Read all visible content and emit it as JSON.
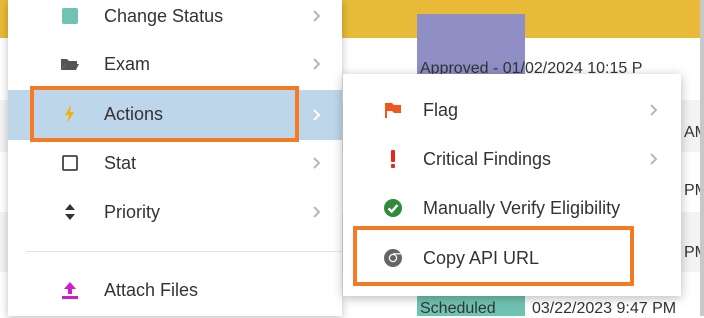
{
  "menu": {
    "items": [
      {
        "label": "Change Status",
        "icon": "change-status-icon",
        "submenu": true
      },
      {
        "label": "Exam",
        "icon": "folder-open-icon",
        "submenu": true
      },
      {
        "label": "Actions",
        "icon": "lightning-icon",
        "submenu": true,
        "selected": true
      },
      {
        "label": "Stat",
        "icon": "checkbox-icon",
        "submenu": true
      },
      {
        "label": "Priority",
        "icon": "sort-icon",
        "submenu": true
      },
      {
        "label": "Attach Files",
        "icon": "upload-icon",
        "submenu": false
      }
    ]
  },
  "submenu": {
    "items": [
      {
        "label": "Flag",
        "icon": "flag-icon",
        "submenu": true
      },
      {
        "label": "Critical Findings",
        "icon": "exclamation-icon",
        "submenu": true
      },
      {
        "label": "Manually Verify Eligibility",
        "icon": "check-circle-icon",
        "submenu": false
      },
      {
        "label": "Copy API URL",
        "icon": "chrome-icon",
        "submenu": false,
        "highlighted": true
      }
    ]
  },
  "background": {
    "row1_text": "Approved - 01/02/2024 10:15 P",
    "row2_text": "Scheduled",
    "row2_date": "03/22/2023 9:47 PM",
    "partial_am": "AM",
    "partial_pm1": "PM",
    "partial_pm2": "PM"
  },
  "colors": {
    "accent_highlight": "#f47a24",
    "selected_bg": "#bed6ea",
    "banner": "#e8ba38",
    "status_purple": "#8f8fc6",
    "status_teal": "#6fc3b2"
  }
}
